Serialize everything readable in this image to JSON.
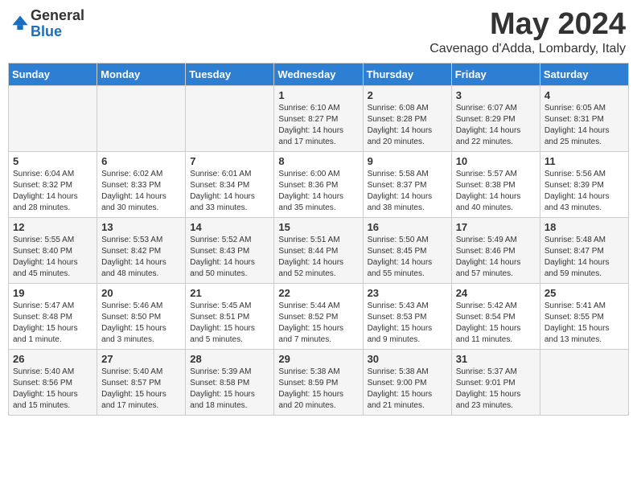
{
  "header": {
    "logo_general": "General",
    "logo_blue": "Blue",
    "month_title": "May 2024",
    "subtitle": "Cavenago d'Adda, Lombardy, Italy"
  },
  "weekdays": [
    "Sunday",
    "Monday",
    "Tuesday",
    "Wednesday",
    "Thursday",
    "Friday",
    "Saturday"
  ],
  "weeks": [
    [
      {
        "day": "",
        "info": ""
      },
      {
        "day": "",
        "info": ""
      },
      {
        "day": "",
        "info": ""
      },
      {
        "day": "1",
        "info": "Sunrise: 6:10 AM\nSunset: 8:27 PM\nDaylight: 14 hours\nand 17 minutes."
      },
      {
        "day": "2",
        "info": "Sunrise: 6:08 AM\nSunset: 8:28 PM\nDaylight: 14 hours\nand 20 minutes."
      },
      {
        "day": "3",
        "info": "Sunrise: 6:07 AM\nSunset: 8:29 PM\nDaylight: 14 hours\nand 22 minutes."
      },
      {
        "day": "4",
        "info": "Sunrise: 6:05 AM\nSunset: 8:31 PM\nDaylight: 14 hours\nand 25 minutes."
      }
    ],
    [
      {
        "day": "5",
        "info": "Sunrise: 6:04 AM\nSunset: 8:32 PM\nDaylight: 14 hours\nand 28 minutes."
      },
      {
        "day": "6",
        "info": "Sunrise: 6:02 AM\nSunset: 8:33 PM\nDaylight: 14 hours\nand 30 minutes."
      },
      {
        "day": "7",
        "info": "Sunrise: 6:01 AM\nSunset: 8:34 PM\nDaylight: 14 hours\nand 33 minutes."
      },
      {
        "day": "8",
        "info": "Sunrise: 6:00 AM\nSunset: 8:36 PM\nDaylight: 14 hours\nand 35 minutes."
      },
      {
        "day": "9",
        "info": "Sunrise: 5:58 AM\nSunset: 8:37 PM\nDaylight: 14 hours\nand 38 minutes."
      },
      {
        "day": "10",
        "info": "Sunrise: 5:57 AM\nSunset: 8:38 PM\nDaylight: 14 hours\nand 40 minutes."
      },
      {
        "day": "11",
        "info": "Sunrise: 5:56 AM\nSunset: 8:39 PM\nDaylight: 14 hours\nand 43 minutes."
      }
    ],
    [
      {
        "day": "12",
        "info": "Sunrise: 5:55 AM\nSunset: 8:40 PM\nDaylight: 14 hours\nand 45 minutes."
      },
      {
        "day": "13",
        "info": "Sunrise: 5:53 AM\nSunset: 8:42 PM\nDaylight: 14 hours\nand 48 minutes."
      },
      {
        "day": "14",
        "info": "Sunrise: 5:52 AM\nSunset: 8:43 PM\nDaylight: 14 hours\nand 50 minutes."
      },
      {
        "day": "15",
        "info": "Sunrise: 5:51 AM\nSunset: 8:44 PM\nDaylight: 14 hours\nand 52 minutes."
      },
      {
        "day": "16",
        "info": "Sunrise: 5:50 AM\nSunset: 8:45 PM\nDaylight: 14 hours\nand 55 minutes."
      },
      {
        "day": "17",
        "info": "Sunrise: 5:49 AM\nSunset: 8:46 PM\nDaylight: 14 hours\nand 57 minutes."
      },
      {
        "day": "18",
        "info": "Sunrise: 5:48 AM\nSunset: 8:47 PM\nDaylight: 14 hours\nand 59 minutes."
      }
    ],
    [
      {
        "day": "19",
        "info": "Sunrise: 5:47 AM\nSunset: 8:48 PM\nDaylight: 15 hours\nand 1 minute."
      },
      {
        "day": "20",
        "info": "Sunrise: 5:46 AM\nSunset: 8:50 PM\nDaylight: 15 hours\nand 3 minutes."
      },
      {
        "day": "21",
        "info": "Sunrise: 5:45 AM\nSunset: 8:51 PM\nDaylight: 15 hours\nand 5 minutes."
      },
      {
        "day": "22",
        "info": "Sunrise: 5:44 AM\nSunset: 8:52 PM\nDaylight: 15 hours\nand 7 minutes."
      },
      {
        "day": "23",
        "info": "Sunrise: 5:43 AM\nSunset: 8:53 PM\nDaylight: 15 hours\nand 9 minutes."
      },
      {
        "day": "24",
        "info": "Sunrise: 5:42 AM\nSunset: 8:54 PM\nDaylight: 15 hours\nand 11 minutes."
      },
      {
        "day": "25",
        "info": "Sunrise: 5:41 AM\nSunset: 8:55 PM\nDaylight: 15 hours\nand 13 minutes."
      }
    ],
    [
      {
        "day": "26",
        "info": "Sunrise: 5:40 AM\nSunset: 8:56 PM\nDaylight: 15 hours\nand 15 minutes."
      },
      {
        "day": "27",
        "info": "Sunrise: 5:40 AM\nSunset: 8:57 PM\nDaylight: 15 hours\nand 17 minutes."
      },
      {
        "day": "28",
        "info": "Sunrise: 5:39 AM\nSunset: 8:58 PM\nDaylight: 15 hours\nand 18 minutes."
      },
      {
        "day": "29",
        "info": "Sunrise: 5:38 AM\nSunset: 8:59 PM\nDaylight: 15 hours\nand 20 minutes."
      },
      {
        "day": "30",
        "info": "Sunrise: 5:38 AM\nSunset: 9:00 PM\nDaylight: 15 hours\nand 21 minutes."
      },
      {
        "day": "31",
        "info": "Sunrise: 5:37 AM\nSunset: 9:01 PM\nDaylight: 15 hours\nand 23 minutes."
      },
      {
        "day": "",
        "info": ""
      }
    ]
  ]
}
